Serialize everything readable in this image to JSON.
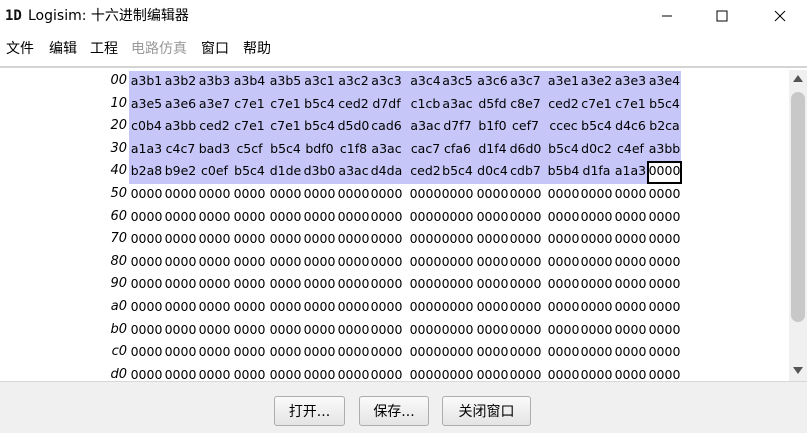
{
  "window": {
    "icon_label": "1D",
    "title": "Logisim: 十六进制编辑器",
    "controls": [
      "minimize",
      "maximize",
      "close"
    ]
  },
  "menubar": {
    "items": [
      {
        "label": "文件",
        "enabled": true
      },
      {
        "label": "编辑",
        "enabled": true
      },
      {
        "label": "工程",
        "enabled": true
      },
      {
        "label": "电路仿真",
        "enabled": false
      },
      {
        "label": "窗口",
        "enabled": true
      },
      {
        "label": "帮助",
        "enabled": true
      }
    ]
  },
  "hex_editor": {
    "selection_color": "#c6c6f8",
    "cursor_cell": {
      "row": 4,
      "col": 15
    },
    "rows": [
      {
        "addr": "00",
        "cells": [
          "a3b1",
          "a3b2",
          "a3b3",
          "a3b4",
          "a3b5",
          "a3c1",
          "a3c2",
          "a3c3",
          "a3c4",
          "a3c5",
          "a3c6",
          "a3c7",
          "a3e1",
          "a3e2",
          "a3e3",
          "a3e4"
        ]
      },
      {
        "addr": "10",
        "cells": [
          "a3e5",
          "a3e6",
          "a3e7",
          "c7e1",
          "c7e1",
          "b5c4",
          "ced2",
          "d7df",
          "c1cb",
          "a3ac",
          "d5fd",
          "c8e7",
          "ced2",
          "c7e1",
          "c7e1",
          "b5c4"
        ]
      },
      {
        "addr": "20",
        "cells": [
          "c0b4",
          "a3bb",
          "ced2",
          "c7e1",
          "c7e1",
          "b5c4",
          "d5d0",
          "cad6",
          "a3ac",
          "d7f7",
          "b1f0",
          "cef7",
          "ccec",
          "b5c4",
          "d4c6",
          "b2ca"
        ]
      },
      {
        "addr": "30",
        "cells": [
          "a1a3",
          "c4c7",
          "bad3",
          "c5cf",
          "b5c4",
          "bdf0",
          "c1f8",
          "a3ac",
          "cac7",
          "cfa6",
          "d1f4",
          "d6d0",
          "b5c4",
          "d0c2",
          "c4ef",
          "a3bb"
        ]
      },
      {
        "addr": "40",
        "cells": [
          "b2a8",
          "b9e2",
          "c0ef",
          "b5c4",
          "d1de",
          "d3b0",
          "a3ac",
          "d4da",
          "ced2",
          "b5c4",
          "d0c4",
          "cdb7",
          "b5b4",
          "d1fa",
          "a1a3",
          "0000"
        ]
      },
      {
        "addr": "50",
        "cells": [
          "0000",
          "0000",
          "0000",
          "0000",
          "0000",
          "0000",
          "0000",
          "0000",
          "0000",
          "0000",
          "0000",
          "0000",
          "0000",
          "0000",
          "0000",
          "0000"
        ]
      },
      {
        "addr": "60",
        "cells": [
          "0000",
          "0000",
          "0000",
          "0000",
          "0000",
          "0000",
          "0000",
          "0000",
          "0000",
          "0000",
          "0000",
          "0000",
          "0000",
          "0000",
          "0000",
          "0000"
        ]
      },
      {
        "addr": "70",
        "cells": [
          "0000",
          "0000",
          "0000",
          "0000",
          "0000",
          "0000",
          "0000",
          "0000",
          "0000",
          "0000",
          "0000",
          "0000",
          "0000",
          "0000",
          "0000",
          "0000"
        ]
      },
      {
        "addr": "80",
        "cells": [
          "0000",
          "0000",
          "0000",
          "0000",
          "0000",
          "0000",
          "0000",
          "0000",
          "0000",
          "0000",
          "0000",
          "0000",
          "0000",
          "0000",
          "0000",
          "0000"
        ]
      },
      {
        "addr": "90",
        "cells": [
          "0000",
          "0000",
          "0000",
          "0000",
          "0000",
          "0000",
          "0000",
          "0000",
          "0000",
          "0000",
          "0000",
          "0000",
          "0000",
          "0000",
          "0000",
          "0000"
        ]
      },
      {
        "addr": "a0",
        "cells": [
          "0000",
          "0000",
          "0000",
          "0000",
          "0000",
          "0000",
          "0000",
          "0000",
          "0000",
          "0000",
          "0000",
          "0000",
          "0000",
          "0000",
          "0000",
          "0000"
        ]
      },
      {
        "addr": "b0",
        "cells": [
          "0000",
          "0000",
          "0000",
          "0000",
          "0000",
          "0000",
          "0000",
          "0000",
          "0000",
          "0000",
          "0000",
          "0000",
          "0000",
          "0000",
          "0000",
          "0000"
        ]
      },
      {
        "addr": "c0",
        "cells": [
          "0000",
          "0000",
          "0000",
          "0000",
          "0000",
          "0000",
          "0000",
          "0000",
          "0000",
          "0000",
          "0000",
          "0000",
          "0000",
          "0000",
          "0000",
          "0000"
        ]
      },
      {
        "addr": "d0",
        "cells": [
          "0000",
          "0000",
          "0000",
          "0000",
          "0000",
          "0000",
          "0000",
          "0000",
          "0000",
          "0000",
          "0000",
          "0000",
          "0000",
          "0000",
          "0000",
          "0000"
        ]
      }
    ]
  },
  "buttons": {
    "open": "打开...",
    "save": "保存...",
    "close": "关闭窗口"
  }
}
